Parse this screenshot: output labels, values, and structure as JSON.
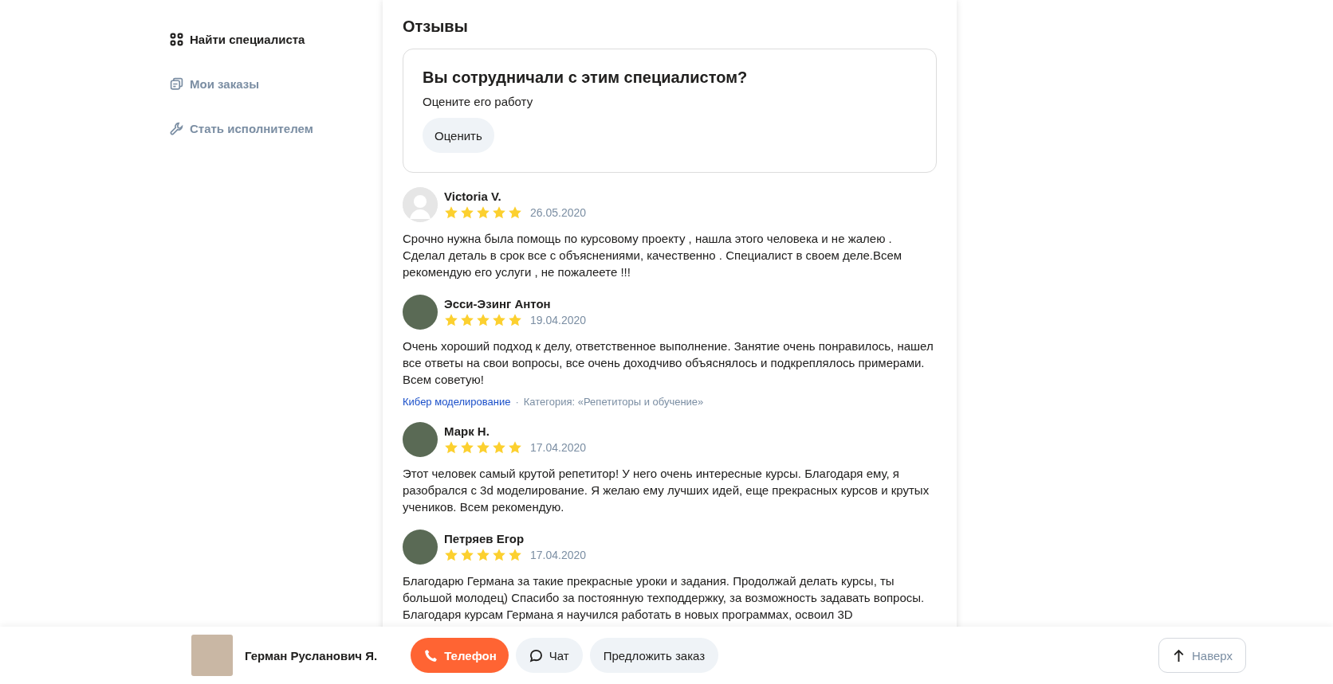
{
  "sidebar": {
    "items": [
      {
        "label": "Найти специалиста",
        "kind": "grid",
        "selected": true
      },
      {
        "label": "Мои заказы",
        "kind": "orders",
        "selected": false
      },
      {
        "label": "Стать исполнителем",
        "kind": "wrench",
        "selected": false
      }
    ]
  },
  "reviews_panel": {
    "title": "Отзывы",
    "prompt": {
      "title": "Вы сотрудничали с этим специалистом?",
      "subtitle": "Оцените его работу",
      "button": "Оценить"
    },
    "reviews": [
      {
        "author": "Victoria V.",
        "has_photo": false,
        "stars": 5,
        "date": "26.05.2020",
        "text": "Срочно нужна была помощь по курсовому проекту , нашла этого человека и не жалею . Сделал деталь в срок все с объяснениями, качественно . Специалист в своем деле.Всем рекомендую его услуги , не пожалеете !!!"
      },
      {
        "author": "Эсси-Эзинг Антон",
        "has_photo": true,
        "stars": 5,
        "date": "19.04.2020",
        "text": "Очень хороший подход к делу, ответственное выполнение. Занятие очень понравилось, нашел все ответы на свои вопросы, все очень доходчиво объяснялось и подкреплялось примерами. Всем советую!",
        "service_link": "Кибер моделирование",
        "separator": "·",
        "category": "Категория: «Репетиторы и обучение»"
      },
      {
        "author": "Марк Н.",
        "has_photo": true,
        "stars": 5,
        "date": "17.04.2020",
        "text": "Этот человек самый крутой репетитор! У него очень интересные курсы. Благодаря ему, я разобрался с 3d моделирование. Я желаю ему лучших идей, еще прекрасных курсов и крутых учеников. Всем рекомендую."
      },
      {
        "author": "Петряев Егор",
        "has_photo": true,
        "stars": 5,
        "date": "17.04.2020",
        "text": "Благодарю Германа за такие прекрасные уроки и задания. Продолжай делать курсы, ты большой молодец) Спасибо за постоянную техподдержку, за возможность задавать вопросы. Благодаря курсам Германа я научился работать в новых программах, освоил 3D"
      }
    ]
  },
  "bottom_bar": {
    "specialist_name": "Герман Русланович Я.",
    "buttons": [
      {
        "kind": "phone",
        "label": "Телефон"
      },
      {
        "kind": "chat",
        "label": "Чат"
      },
      {
        "kind": "plain",
        "label": "Предложить заказ"
      }
    ],
    "scroll_top": "Наверх"
  }
}
